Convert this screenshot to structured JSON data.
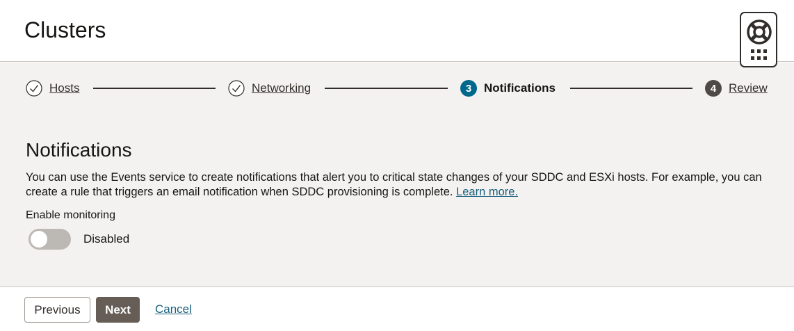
{
  "header": {
    "title": "Clusters",
    "help_icon": "lifebuoy-icon",
    "apps_icon": "app-grid-icon"
  },
  "train": {
    "steps": [
      {
        "label": "Hosts",
        "status": "completed",
        "icon": "check-circle-icon"
      },
      {
        "label": "Networking",
        "status": "completed",
        "icon": "check-circle-icon"
      },
      {
        "label": "Notifications",
        "status": "current",
        "number": "3"
      },
      {
        "label": "Review",
        "status": "upcoming",
        "number": "4"
      }
    ]
  },
  "section": {
    "title": "Notifications",
    "description": "You can use the Events service to create notifications that alert you to critical state changes of your SDDC and ESXi hosts. For example, you can create a rule that triggers an email notification when SDDC provisioning is complete. ",
    "learn_more": "Learn more.",
    "monitoring_label": "Enable monitoring",
    "monitoring_state": "Disabled",
    "monitoring_enabled": false
  },
  "footer": {
    "previous_label": "Previous",
    "next_label": "Next",
    "cancel_label": "Cancel"
  },
  "colors": {
    "accent": "#1a607d",
    "current_step": "#00688c",
    "upcoming_step": "#4f4a45",
    "primary_button": "#655d56",
    "panel_background": "#f4f2f0"
  }
}
